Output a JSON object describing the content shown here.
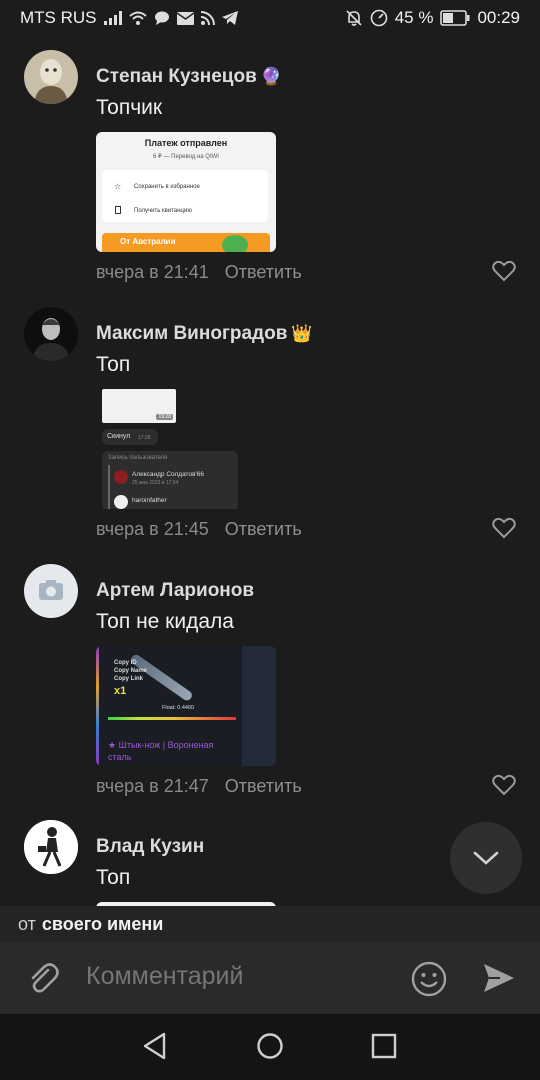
{
  "status_bar": {
    "carrier": "MTS RUS",
    "battery": "45 %",
    "time": "00:29"
  },
  "comments": [
    {
      "author": "Степан Кузнецов",
      "badge": "🔮",
      "text": "Топчик",
      "time": "вчера в 21:41",
      "reply": "Ответить",
      "attachment": {
        "type": "payment-receipt",
        "title": "Платеж отправлен",
        "subtitle": "6 ₽ — Перевод на QIWI",
        "row1": "Сохранить в избранное",
        "row2": "Получить квитанцию",
        "banner": "От Австралии"
      }
    },
    {
      "author": "Максим Виноградов",
      "badge": "👑",
      "text": "Топ",
      "time": "вчера в 21:45",
      "reply": "Ответить",
      "attachment": {
        "type": "chat-screenshot",
        "bubble_time": "19:28",
        "msg": "Скинул",
        "msg_time": "17:28",
        "header": "Запись пользователя",
        "post_author": "Александр Солдатов'66",
        "post_date": "25 мая 2023 в 17:04",
        "post_user": "haroinfather"
      }
    },
    {
      "author": "Артем Ларионов",
      "badge": "",
      "text": "Топ не кидала",
      "time": "вчера в 21:47",
      "reply": "Ответить",
      "attachment": {
        "type": "game-item",
        "menu1": "Copy ID",
        "menu2": "Copy Name",
        "menu3": "Copy Link",
        "qty": "x1",
        "float": "Float: 0.4460",
        "item_name": "★ Штык-нож | Вороненая сталь"
      }
    },
    {
      "author": "Влад Кузин",
      "badge": "",
      "text": "Топ",
      "time": "",
      "reply": "",
      "attachment": {
        "type": "partial"
      }
    }
  ],
  "composer": {
    "from_prefix": "от",
    "from_name": "своего имени",
    "placeholder": "Комментарий"
  },
  "colors": {
    "background": "#1c1c1c",
    "accent_orange": "#f59a23",
    "text_secondary": "#8a8a8a"
  }
}
